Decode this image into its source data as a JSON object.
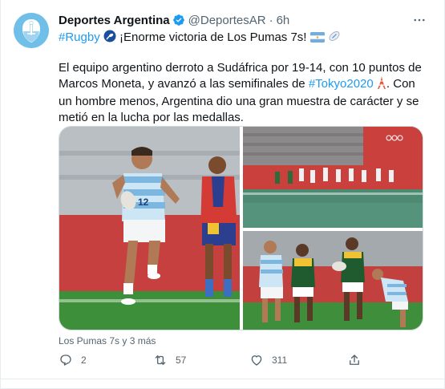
{
  "author": {
    "name": "Deportes Argentina",
    "handle": "@DeportesAR",
    "separator": "·",
    "time": "6h"
  },
  "tweet": {
    "hashtag_rugby": "#Rugby",
    "headline": "¡Enorme victoria de Los Pumas 7s!",
    "body_part1": "El equipo argentino derroto a Sudáfrica por 19-14, con 10 puntos de Marcos Moneta, y avanzó a las semifinales de ",
    "hashtag_tokyo": "#Tokyo2020",
    "body_part2": ". Con un hombre menos, Argentina dio una gran muestra de carácter y se metió en la lucha por las medallas."
  },
  "tagged_people": "Los Pumas 7s y 3 más",
  "actions": {
    "replies": "2",
    "retweets": "57",
    "likes": "311"
  },
  "icons": {
    "verified": "verified-badge-icon",
    "more": "more-options-icon",
    "reply": "reply-icon",
    "retweet": "retweet-icon",
    "like": "heart-icon",
    "share": "share-icon"
  },
  "colors": {
    "link": "#1d9bf0",
    "secondary_text": "#536471",
    "verified": "#1d9bf0"
  }
}
